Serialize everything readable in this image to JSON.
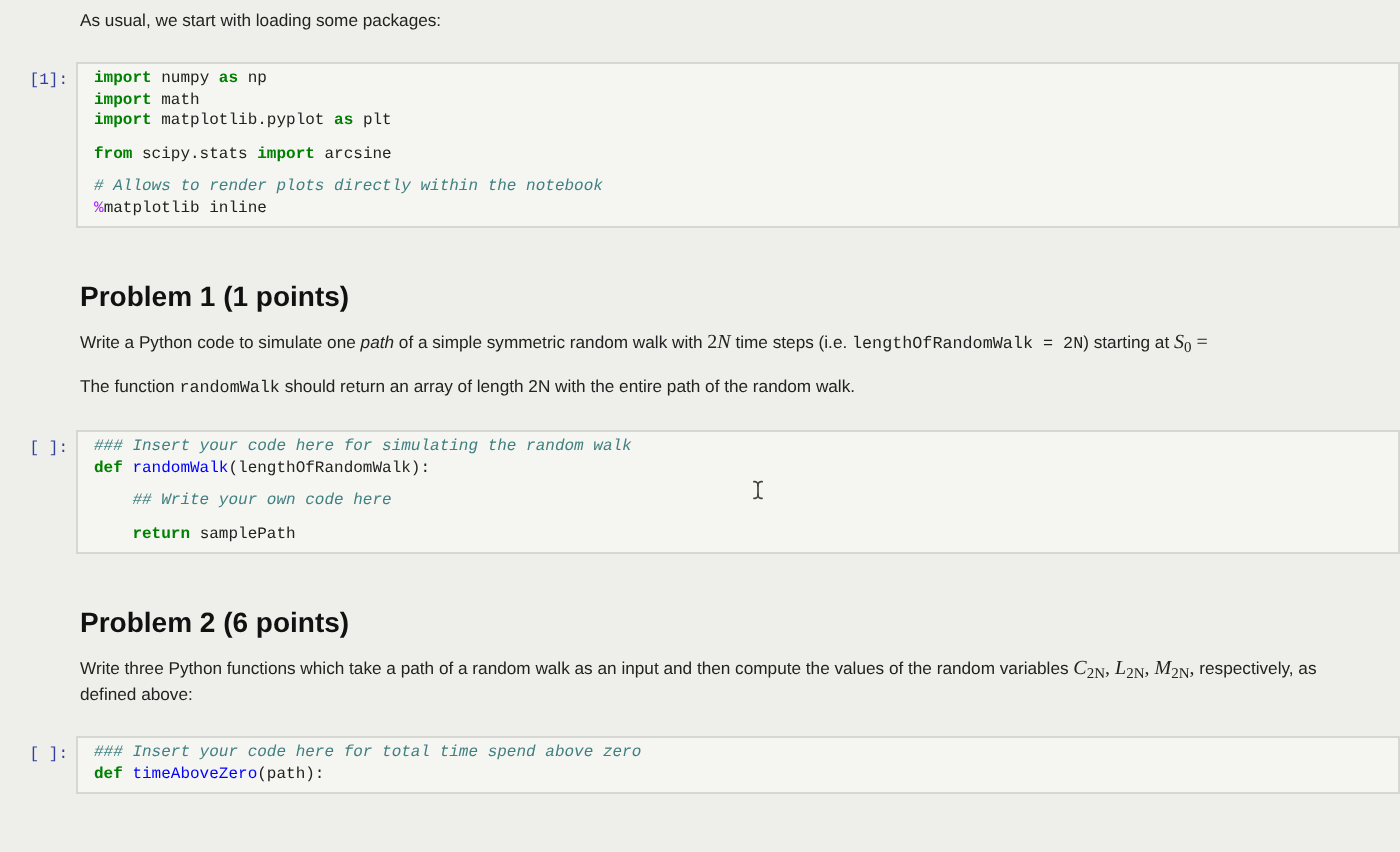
{
  "cells": [
    {
      "kind": "markdown",
      "paragraphs": [
        [
          {
            "kind": "text",
            "text": "As usual, we start with loading some packages:"
          }
        ]
      ]
    },
    {
      "kind": "code",
      "prompt": "[1]:",
      "cursor": false,
      "blocks": [
        [
          [
            {
              "kind": "keyword",
              "text": "import"
            },
            {
              "kind": "plain",
              "text": " numpy "
            },
            {
              "kind": "keyword",
              "text": "as"
            },
            {
              "kind": "plain",
              "text": " np"
            }
          ],
          [
            {
              "kind": "keyword",
              "text": "import"
            },
            {
              "kind": "plain",
              "text": " math"
            }
          ],
          [
            {
              "kind": "keyword",
              "text": "import"
            },
            {
              "kind": "plain",
              "text": " matplotlib.pyplot "
            },
            {
              "kind": "keyword",
              "text": "as"
            },
            {
              "kind": "plain",
              "text": " plt"
            }
          ]
        ],
        [
          [
            {
              "kind": "keyword",
              "text": "from"
            },
            {
              "kind": "plain",
              "text": " scipy.stats "
            },
            {
              "kind": "keyword",
              "text": "import"
            },
            {
              "kind": "plain",
              "text": " arcsine"
            }
          ]
        ],
        [
          [
            {
              "kind": "comment",
              "text": "# Allows to render plots directly within the notebook"
            }
          ],
          [
            {
              "kind": "magic",
              "text": "%"
            },
            {
              "kind": "plain",
              "text": "matplotlib inline"
            }
          ]
        ]
      ]
    },
    {
      "kind": "markdown",
      "heading": "Problem 1 (1 points)",
      "paragraphs": [
        [
          {
            "kind": "text",
            "text": "Write a Python code to simulate one "
          },
          {
            "kind": "text",
            "text": "*path*"
          },
          {
            "kind": "text",
            "text": " of a simple symmetric random walk with "
          },
          {
            "kind": "math",
            "text": "2"
          },
          {
            "kind": "math",
            "text": "*N*"
          },
          {
            "kind": "text",
            "text": " time steps (i.e. "
          },
          {
            "kind": "code",
            "text": "lengthOfRandomWalk = 2N"
          },
          {
            "kind": "text",
            "text": ") starting at "
          },
          {
            "kind": "math",
            "text": "*S*$_{0}$ ="
          }
        ],
        [
          {
            "kind": "text",
            "text": "The function "
          },
          {
            "kind": "code",
            "text": "randomWalk"
          },
          {
            "kind": "text",
            "text": " should return an array of length 2N with the entire path of the random walk."
          }
        ]
      ]
    },
    {
      "kind": "code",
      "prompt": "[ ]:",
      "cursor": true,
      "blocks": [
        [
          [
            {
              "kind": "comment",
              "text": "### Insert your code here for simulating the random walk"
            }
          ],
          [
            {
              "kind": "keyword",
              "text": "def"
            },
            {
              "kind": "function",
              "text": "randomWalk"
            },
            {
              "kind": "plain",
              "text": "(lengthOfRandomWalk):"
            }
          ]
        ],
        [
          [
            {
              "kind": "indent"
            },
            {
              "kind": "comment",
              "text": "## Write your own code here"
            }
          ]
        ],
        [
          [
            {
              "kind": "indent"
            },
            {
              "kind": "keyword",
              "text": "return"
            },
            {
              "kind": "plain",
              "text": " samplePath"
            }
          ]
        ]
      ]
    },
    {
      "kind": "markdown",
      "heading": "Problem 2 (6 points)",
      "paragraphs": [
        [
          {
            "kind": "text",
            "text": "Write three Python functions which take a path of a random walk as an input and then compute the values of the random variables "
          },
          {
            "kind": "math",
            "text": "*C*$_{2N}$, *L*$_{2N}$, *M*$_{2N}$,"
          },
          {
            "kind": "text",
            "text": " respectively, as defined above:"
          }
        ]
      ]
    },
    {
      "kind": "code",
      "prompt": "[ ]:",
      "cursor": false,
      "blocks": [
        [
          [
            {
              "kind": "comment",
              "text": "### Insert your code here for total time spend above zero"
            }
          ],
          [
            {
              "kind": "keyword",
              "text": "def"
            },
            {
              "kind": "function",
              "text": "timeAboveZero"
            },
            {
              "kind": "plain",
              "text": "(path):"
            }
          ]
        ]
      ]
    }
  ]
}
